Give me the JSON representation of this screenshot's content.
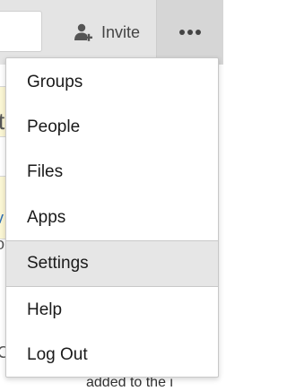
{
  "header": {
    "invite_label": "Invite",
    "invite_icon": "add-person-icon",
    "more_icon": "more-horizontal-icon"
  },
  "menu": {
    "items": [
      {
        "label": "Groups"
      },
      {
        "label": "People"
      },
      {
        "label": "Files"
      },
      {
        "label": "Apps"
      },
      {
        "label": "Settings",
        "selected": true
      },
      {
        "label": "Help"
      },
      {
        "label": "Log Out"
      }
    ]
  },
  "background": {
    "fragment_1": "t",
    "fragment_2": "v",
    "fragment_3": "o",
    "fragment_4": "C",
    "bottom_text": "added to the i"
  },
  "colors": {
    "topbar": "#e4e4e4",
    "more_button": "#d6d6d6",
    "selected_item": "#e6e6e6",
    "highlight_strip": "#fbf6d4",
    "link": "#2f6fb5"
  }
}
